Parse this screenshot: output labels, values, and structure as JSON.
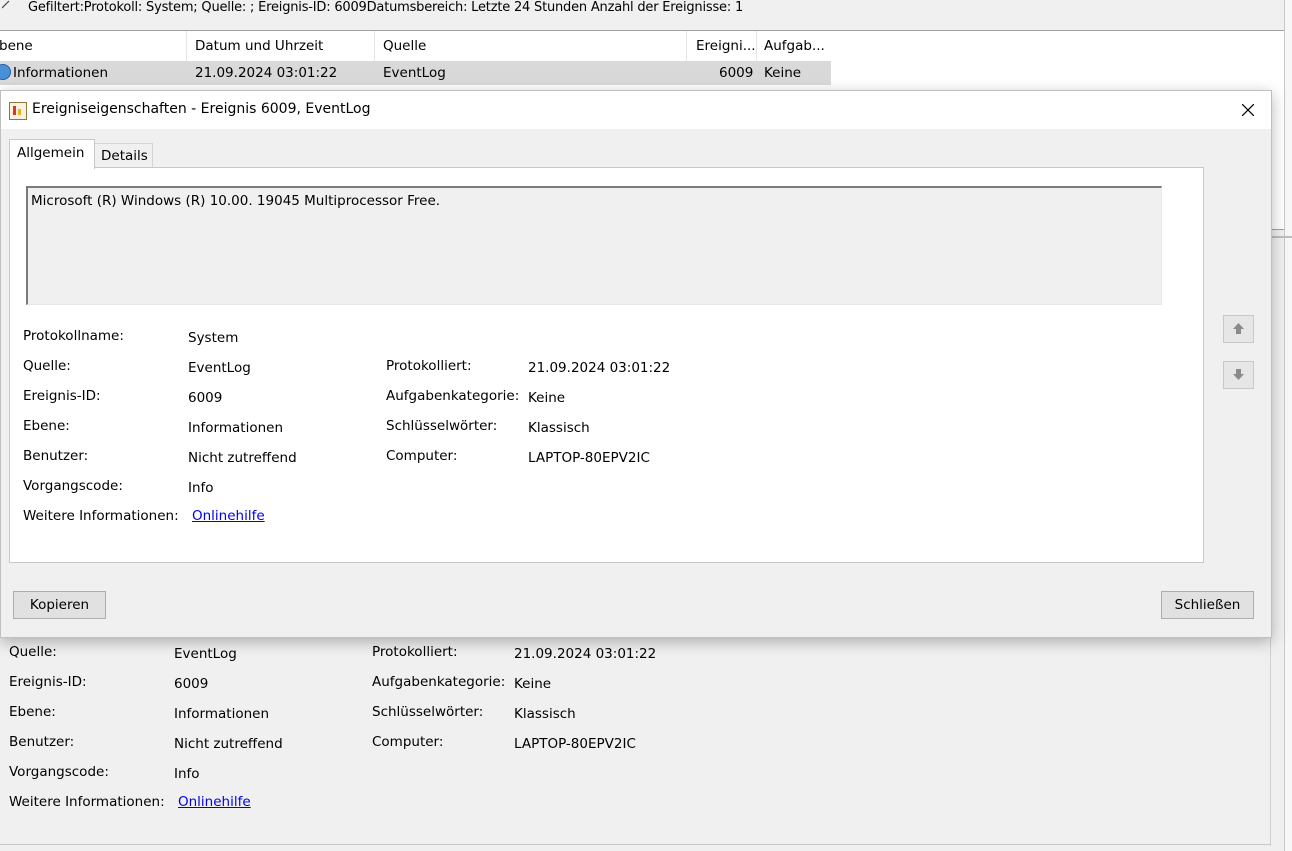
{
  "filter": {
    "text": "Gefiltert:Protokoll: System; Quelle: ; Ereignis-ID: 6009Datumsbereich: Letzte 24 Stunden Anzahl der Ereignisse: 1"
  },
  "event_list": {
    "columns": [
      "bene",
      "Datum und Uhrzeit",
      "Quelle",
      "Ereigni...",
      "Aufgab..."
    ],
    "rows": [
      {
        "level": "Informationen",
        "datetime": "21.09.2024 03:01:22",
        "source": "EventLog",
        "event_id": "6009",
        "task": "Keine"
      }
    ]
  },
  "dialog": {
    "title": "Ereigniseigenschaften - Ereignis 6009, EventLog",
    "tabs": [
      "Allgemein",
      "Details"
    ],
    "active_tab": "Allgemein",
    "description": "Microsoft (R) Windows (R) 10.00. 19045  Multiprocessor Free.",
    "copy_label": "Kopieren",
    "close_label": "Schließen"
  },
  "labels": {
    "protokollname": "Protokollname:",
    "quelle": "Quelle:",
    "ereignis_id": "Ereignis-ID:",
    "ebene": "Ebene:",
    "benutzer": "Benutzer:",
    "vorgangscode": "Vorgangscode:",
    "weitere_infos": "Weitere Informationen:",
    "protokolliert": "Protokolliert:",
    "aufgabenkategorie": "Aufgabenkategorie:",
    "schluesselwoerter": "Schlüsselwörter:",
    "computer": "Computer:"
  },
  "properties": {
    "protokollname": "System",
    "quelle": "EventLog",
    "ereignis_id": "6009",
    "ebene": "Informationen",
    "benutzer": "Nicht zutreffend",
    "vorgangscode": "Info",
    "weitere_infos": "Onlinehilfe",
    "protokolliert": "21.09.2024 03:01:22",
    "aufgabenkategorie": "Keine",
    "schluesselwoerter": "Klassisch",
    "computer": "LAPTOP-80EPV2IC"
  },
  "colors": {
    "window_bg": "#f0f0f0",
    "selected_row": "#d9d9d9",
    "link": "#0000ee",
    "info_icon": "#4a90d9"
  }
}
